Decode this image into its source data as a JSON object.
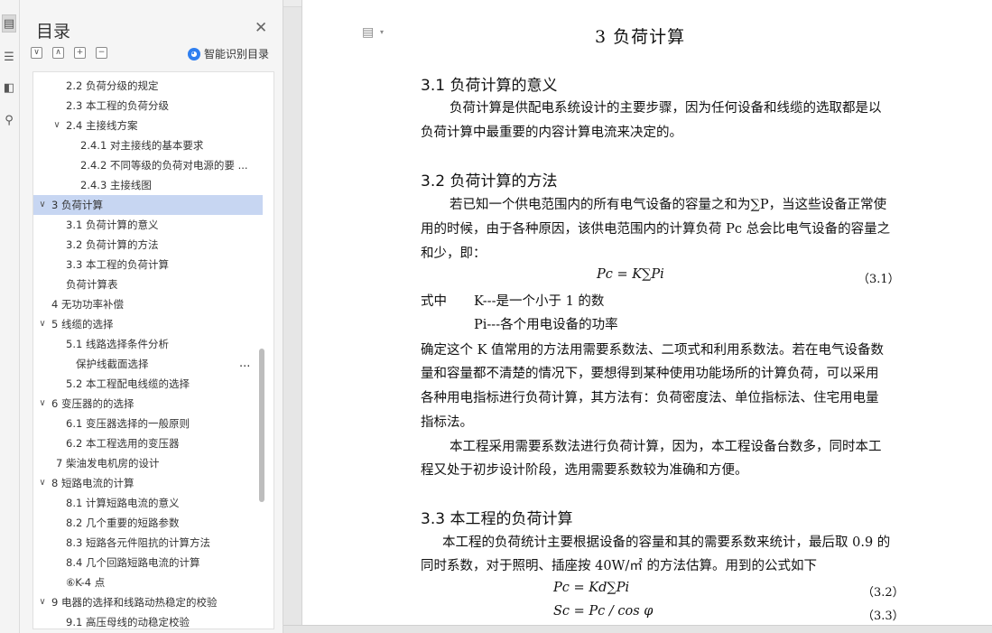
{
  "toc": {
    "title": "目录",
    "smart_label": "智能识别目录",
    "items": [
      {
        "text": "2.2 负荷分级的规定",
        "indent": 2
      },
      {
        "text": "2.3 本工程的负荷分级",
        "indent": 2
      },
      {
        "text": "2.4 主接线方案",
        "indent": 2,
        "expand": "∨"
      },
      {
        "text": "2.4.1 对主接线的基本要求",
        "indent": 3
      },
      {
        "text": "2.4.2 不同等级的负荷对电源的要 ...",
        "indent": 3
      },
      {
        "text": "2.4.3 主接线图",
        "indent": 3
      },
      {
        "text": "3    负荷计算",
        "indent": 1,
        "expand": "∨",
        "selected": true
      },
      {
        "text": "3.1 负荷计算的意义",
        "indent": 2
      },
      {
        "text": "3.2 负荷计算的方法",
        "indent": 2
      },
      {
        "text": "3.3 本工程的负荷计算",
        "indent": 2
      },
      {
        "text": "负荷计算表",
        "indent": 2
      },
      {
        "text": "4    无功功率补偿",
        "indent": 1
      },
      {
        "text": "5    线缆的选择",
        "indent": 1,
        "expand": "∨"
      },
      {
        "text": "5.1 线路选择条件分析",
        "indent": 2
      },
      {
        "text": "保护线截面选择",
        "indent": 2.6,
        "more": "..."
      },
      {
        "text": "5.2 本工程配电线缆的选择",
        "indent": 2
      },
      {
        "text": "6    变压器的的选择",
        "indent": 1,
        "expand": "∨"
      },
      {
        "text": "6.1 变压器选择的一般原则",
        "indent": 2
      },
      {
        "text": "6.2 本工程选用的变压器",
        "indent": 2
      },
      {
        "text": "7    柴油发电机房的设计",
        "indent": 1.4
      },
      {
        "text": "8    短路电流的计算",
        "indent": 1,
        "expand": "∨"
      },
      {
        "text": "8.1 计算短路电流的意义",
        "indent": 2
      },
      {
        "text": "8.2 几个重要的短路参数",
        "indent": 2
      },
      {
        "text": "8.3 短路各元件阻抗的计算方法",
        "indent": 2
      },
      {
        "text": "8.4    几个回路短路电流的计算",
        "indent": 2
      },
      {
        "text": "⑥K-4 点",
        "indent": 2
      },
      {
        "text": "9    电器的选择和线路动热稳定的校验",
        "indent": 1,
        "expand": "∨"
      },
      {
        "text": "9.1 高压母线的动稳定校验",
        "indent": 2
      }
    ]
  },
  "doc": {
    "chapter": "3    负荷计算",
    "s31_title": "3.1 负荷计算的意义",
    "s31_p1": "负荷计算是供配电系统设计的主要步骤，因为任何设备和线缆的选取都是以",
    "s31_p2": "负荷计算中最重要的内容计算电流来决定的。",
    "s32_title": "3.2 负荷计算的方法",
    "s32_p1": "若已知一个供电范围内的所有电气设备的容量之和为∑P，当这些设备正常使",
    "s32_p2": "用的时候，由于各种原因，该供电范围内的计算负荷 Pc 总会比电气设备的容量之",
    "s32_p3": "和少，即：",
    "eq1": "Pc = K∑Pi",
    "eq1_num": "（3.1）",
    "where1_a": "式中",
    "where1_b": "K---是一个小于 1 的数",
    "where2": "Pi---各个用电设备的功率",
    "p4_1": "确定这个 K 值常用的方法用需要系数法、二项式和利用系数法。若在电气设备数",
    "p4_2": "量和容量都不清楚的情况下，要想得到某种使用功能场所的计算负荷，可以采用",
    "p4_3": "各种用电指标进行负荷计算，其方法有：负荷密度法、单位指标法、住宅用电量",
    "p4_4": "指标法。",
    "p5_1": "本工程采用需要系数法进行负荷计算，因为，本工程设备台数多，同时本工",
    "p5_2": "程又处于初步设计阶段，选用需要系数较为准确和方便。",
    "s33_title": "3.3 本工程的负荷计算",
    "s33_p1": "本工程的负荷统计主要根据设备的容量和其的需要系数来统计，最后取 0.9 的",
    "s33_p2": "同时系数，对于照明、插座按 40W/㎡ 的方法估算。用到的公式如下",
    "eq2": "Pc = Kd∑Pi",
    "eq2_num": "（3.2）",
    "eq3": "Sc = Pc / cos φ",
    "eq3_num": "（3.3）"
  }
}
